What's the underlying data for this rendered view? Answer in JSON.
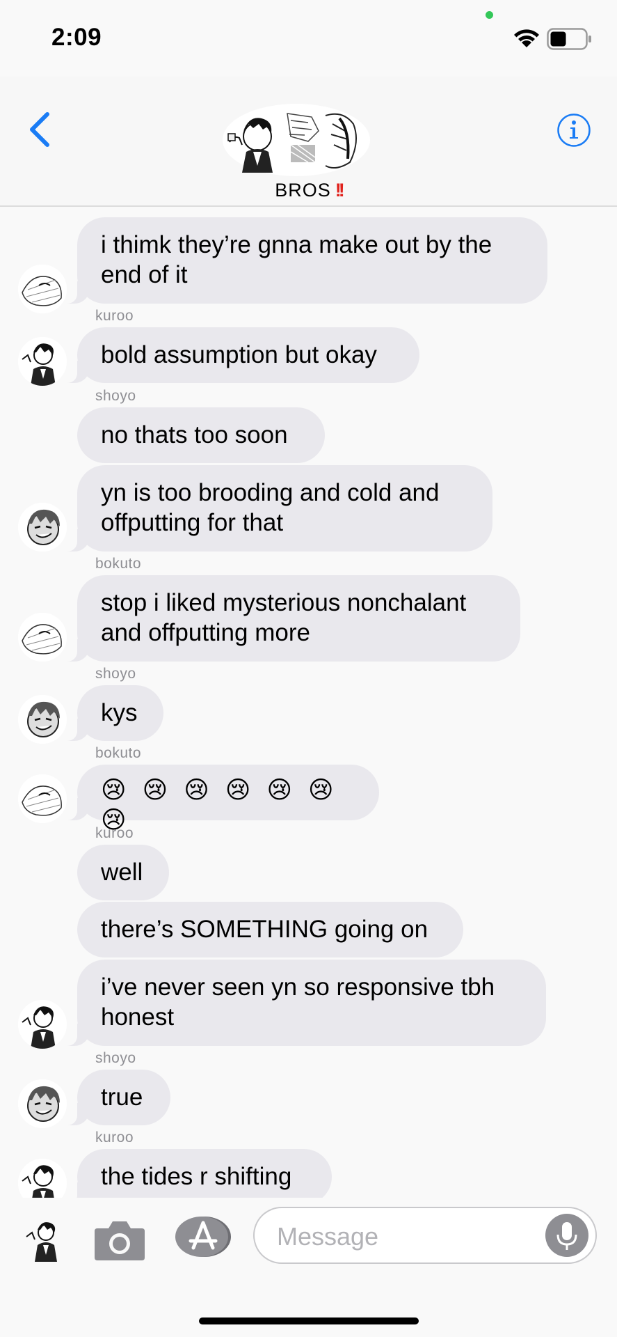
{
  "status_bar": {
    "time": "2:09",
    "battery_level": 0.4
  },
  "header": {
    "group_name": "BROS",
    "group_emoji": "!!",
    "back_icon": "chevron-left-icon",
    "info_icon": "info-circle-icon"
  },
  "messages": [
    {
      "sender": "",
      "text": "i thimk they’re gnna make out by the end of it",
      "avatar": "kuroo-avatar"
    },
    {
      "sender": "kuroo",
      "text": "bold assumption but okay",
      "avatar": "shoyo-avatar"
    },
    {
      "sender": "shoyo",
      "text": "no thats too soon",
      "avatar": ""
    },
    {
      "sender": "",
      "text": "yn is too brooding and cold and offputting for that",
      "avatar": "bokuto-avatar"
    },
    {
      "sender": "bokuto",
      "text": "stop i liked mysterious nonchalant and offputting more",
      "avatar": "kuroo-avatar"
    },
    {
      "sender": "shoyo",
      "text": "kys",
      "avatar": "bokuto-avatar"
    },
    {
      "sender": "bokuto",
      "text": "😢 😢 😢 😢 😢 😢 😢",
      "avatar": "kuroo-avatar"
    },
    {
      "sender": "kuroo",
      "text": "well",
      "avatar": ""
    },
    {
      "sender": "",
      "text": "there’s SOMETHING going on",
      "avatar": ""
    },
    {
      "sender": "",
      "text": "i’ve never seen yn so responsive tbh honest",
      "avatar": "shoyo-avatar"
    },
    {
      "sender": "shoyo",
      "text": "true",
      "avatar": "bokuto-avatar"
    },
    {
      "sender": "kuroo",
      "text": "the tides r shifting",
      "avatar": "shoyo-avatar"
    }
  ],
  "composer": {
    "placeholder": "Message",
    "camera_icon": "camera-icon",
    "appstore_icon": "app-store-icon",
    "mic_icon": "microphone-icon"
  },
  "colors": {
    "accent": "#1a7cf5",
    "bubble": "#e9e8ed",
    "sender_text": "#8e8e93",
    "alert_red": "#e0211b"
  }
}
